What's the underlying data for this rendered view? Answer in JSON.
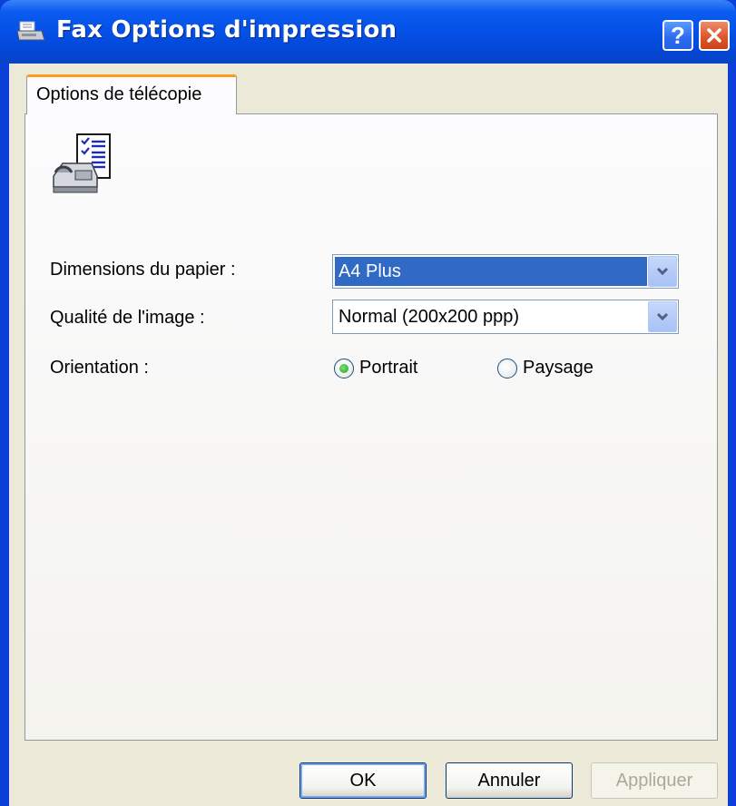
{
  "window": {
    "title": "Fax Options d'impression",
    "help_label": "?",
    "close_label": "✕"
  },
  "tabs": [
    {
      "label": "Options de télécopie",
      "active": true
    }
  ],
  "form": {
    "paper": {
      "label": "Dimensions du papier :",
      "value": "A4 Plus"
    },
    "quality": {
      "label": "Qualité de l'image :",
      "value": "Normal (200x200 ppp)"
    },
    "orientation": {
      "label": "Orientation :",
      "options": [
        {
          "label": "Portrait",
          "selected": true
        },
        {
          "label": "Paysage",
          "selected": false
        }
      ]
    }
  },
  "buttons": {
    "ok": "OK",
    "cancel": "Annuler",
    "apply": "Appliquer"
  },
  "icons": {
    "title": "printer-fax-icon",
    "panel": "fax-options-icon"
  },
  "colors": {
    "titlebar": "#0550e6",
    "selection": "#316ac5",
    "tab_accent": "#ff9a1a",
    "dialog_bg": "#ece9d8"
  }
}
